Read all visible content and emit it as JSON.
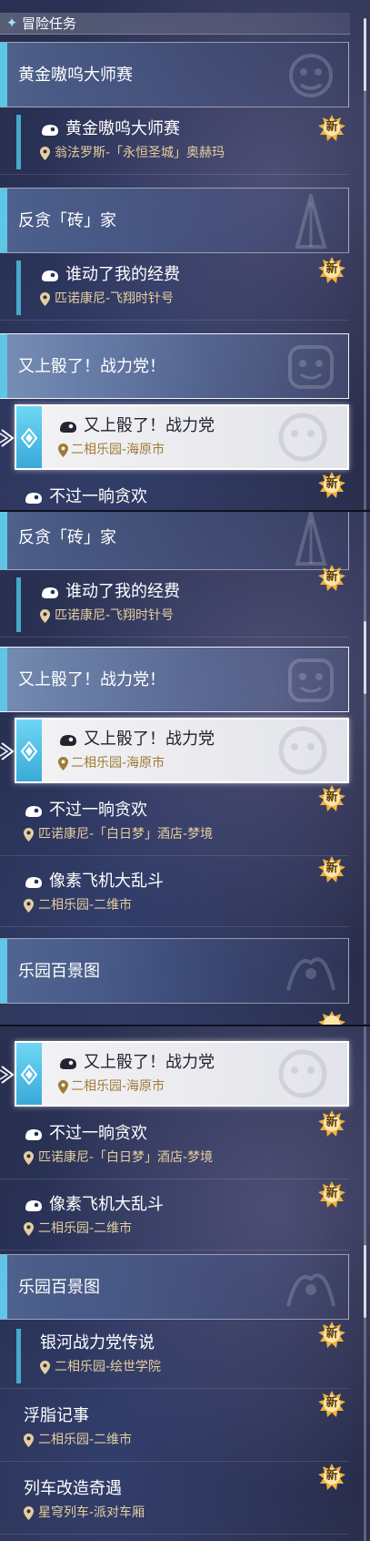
{
  "header": {
    "title": "冒险任务",
    "icon": "diamond-sparkle-icon"
  },
  "badge": {
    "label": "新",
    "color": "#f1b23a"
  },
  "colors": {
    "accent": "#5fc6e8",
    "location_text": "#e6cf9e",
    "selected_location_text": "#a07a36"
  },
  "frame1": {
    "items": [
      {
        "kind": "group",
        "title": "黄金嗷呜大师赛"
      },
      {
        "kind": "quest",
        "title": "黄金嗷呜大师赛",
        "location": "翁法罗斯-「永恒圣城」奥赫玛",
        "badge": "新"
      },
      {
        "kind": "group",
        "title": "反贪「砖」家"
      },
      {
        "kind": "quest",
        "title": "谁动了我的经费",
        "location": "匹诺康尼-飞翔时针号",
        "badge": "新"
      },
      {
        "kind": "group",
        "title": "又上骰了！战力党！"
      },
      {
        "kind": "quest",
        "title": "又上骰了！战力党",
        "location": "二相乐园-海原市",
        "selected": true
      },
      {
        "kind": "quest",
        "title": "不过一晌贪欢",
        "badge": "新"
      }
    ]
  },
  "frame2": {
    "items": [
      {
        "kind": "group",
        "title": "反贪「砖」家"
      },
      {
        "kind": "quest",
        "title": "谁动了我的经费",
        "location": "匹诺康尼-飞翔时针号",
        "badge": "新"
      },
      {
        "kind": "group",
        "title": "又上骰了！战力党！"
      },
      {
        "kind": "quest",
        "title": "又上骰了！战力党",
        "location": "二相乐园-海原市",
        "selected": true
      },
      {
        "kind": "quest",
        "title": "不过一晌贪欢",
        "location": "匹诺康尼-「白日梦」酒店-梦境",
        "badge": "新"
      },
      {
        "kind": "quest",
        "title": "像素飞机大乱斗",
        "location": "二相乐园-二维市",
        "badge": "新"
      },
      {
        "kind": "group",
        "title": "乐园百景图"
      }
    ]
  },
  "frame3": {
    "items": [
      {
        "kind": "quest",
        "title": "又上骰了！战力党",
        "location": "二相乐园-海原市",
        "selected": true
      },
      {
        "kind": "quest",
        "title": "不过一晌贪欢",
        "location": "匹诺康尼-「白日梦」酒店-梦境",
        "badge": "新"
      },
      {
        "kind": "quest",
        "title": "像素飞机大乱斗",
        "location": "二相乐园-二维市",
        "badge": "新"
      },
      {
        "kind": "group",
        "title": "乐园百景图"
      },
      {
        "kind": "quest",
        "title": "银河战力党传说",
        "location": "二相乐园-绘世学院",
        "badge": "新"
      },
      {
        "kind": "quest",
        "title": "浮脂记事",
        "location": "二相乐园-二维市",
        "badge": "新"
      },
      {
        "kind": "quest",
        "title": "列车改造奇遇",
        "location": "星穹列车-派对车厢",
        "badge": "新"
      }
    ]
  }
}
